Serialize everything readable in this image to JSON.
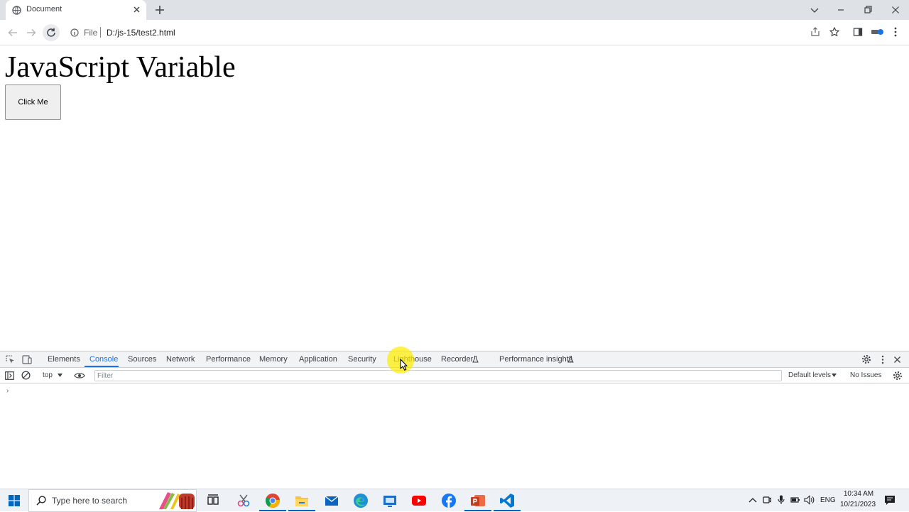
{
  "browser": {
    "tab": {
      "title": "Document"
    },
    "address_bar": {
      "scheme_label": "File",
      "path": "D:/js-15/test2.html"
    }
  },
  "page": {
    "heading": "JavaScript Variable",
    "button_label": "Click Me"
  },
  "devtools": {
    "tabs": [
      "Elements",
      "Console",
      "Sources",
      "Network",
      "Performance",
      "Memory",
      "Application",
      "Security",
      "Lighthouse",
      "Recorder",
      "Performance insights"
    ],
    "active_tab": "Console",
    "context": "top",
    "filter": {
      "placeholder": "Filter",
      "value": ""
    },
    "levels_label": "Default levels",
    "issues_label": "No Issues",
    "prompt": "›"
  },
  "taskbar": {
    "search_placeholder": "Type here to search",
    "language": "ENG",
    "time": "10:34 AM",
    "date": "10/21/2023",
    "apps": [
      "task-view",
      "snipping-tool",
      "chrome",
      "file-explorer",
      "mail",
      "edge",
      "remote-desktop",
      "youtube",
      "facebook",
      "powerpoint",
      "vscode"
    ]
  },
  "colors": {
    "accent": "#1a73e8",
    "taskbar_accent": "#0067c0",
    "cursor_highlight": "#ffeb00"
  }
}
